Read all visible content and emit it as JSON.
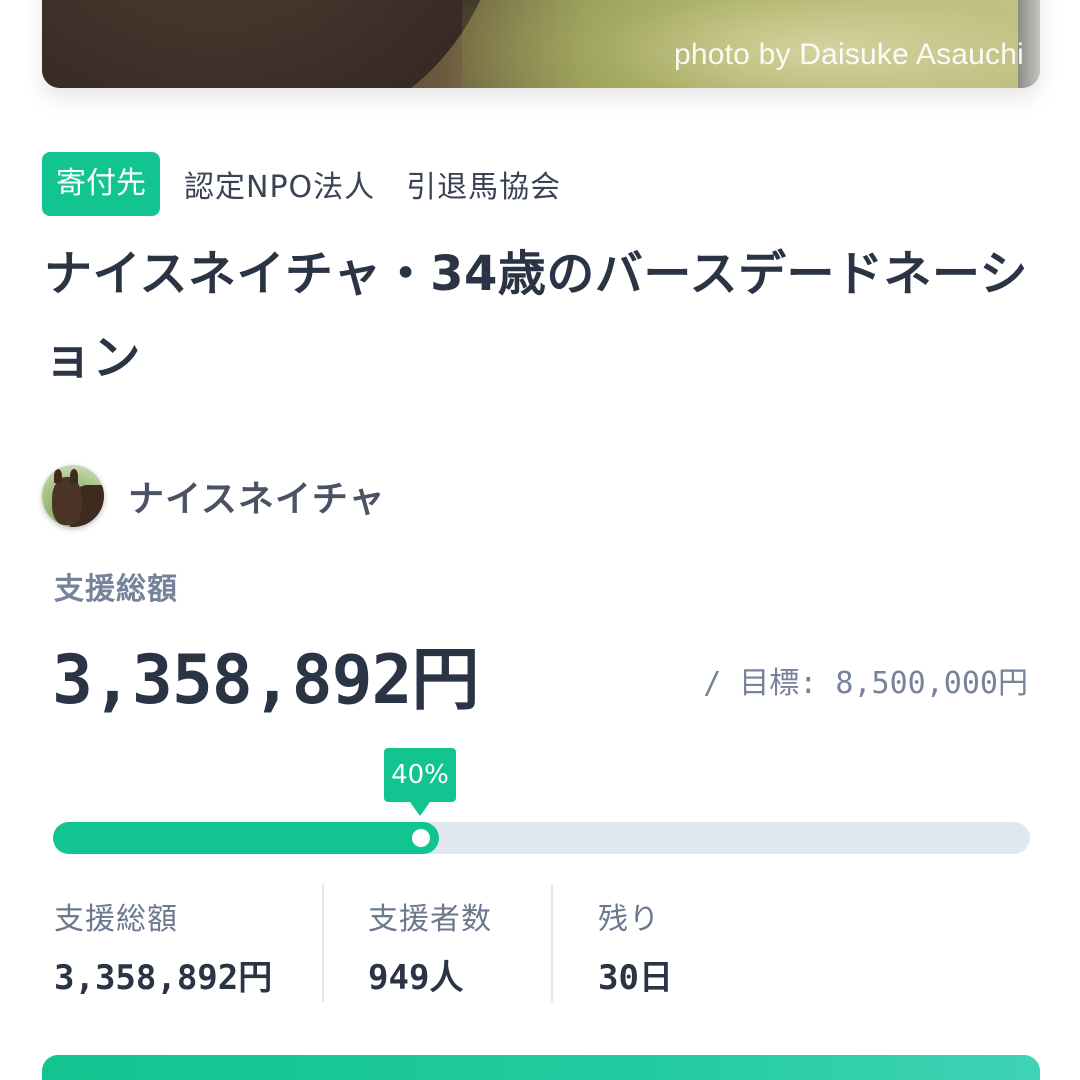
{
  "hero": {
    "photo_credit": "photo by Daisuke Asauchi"
  },
  "recipient": {
    "badge_label": "寄付先",
    "organization": "認定NPO法人　引退馬協会"
  },
  "project": {
    "title": "ナイスネイチャ・34歳のバースデードネーション"
  },
  "owner": {
    "name": "ナイスネイチャ"
  },
  "funding": {
    "total_label": "支援総額",
    "total_amount": "3,358,892円",
    "goal_text": "/ 目標: 8,500,000円",
    "progress_label": "40%",
    "progress_fraction": 0.3952
  },
  "stats": [
    {
      "label": "支援総額",
      "value": "3,358,892円"
    },
    {
      "label": "支援者数",
      "value": "949人"
    },
    {
      "label": "残り",
      "value": "30日"
    }
  ],
  "colors": {
    "accent": "#12c48f",
    "track": "#e1e7ef",
    "text_primary": "#2b3445",
    "text_secondary": "#76839a"
  },
  "icons": {
    "owner_avatar": "horse-avatar"
  }
}
